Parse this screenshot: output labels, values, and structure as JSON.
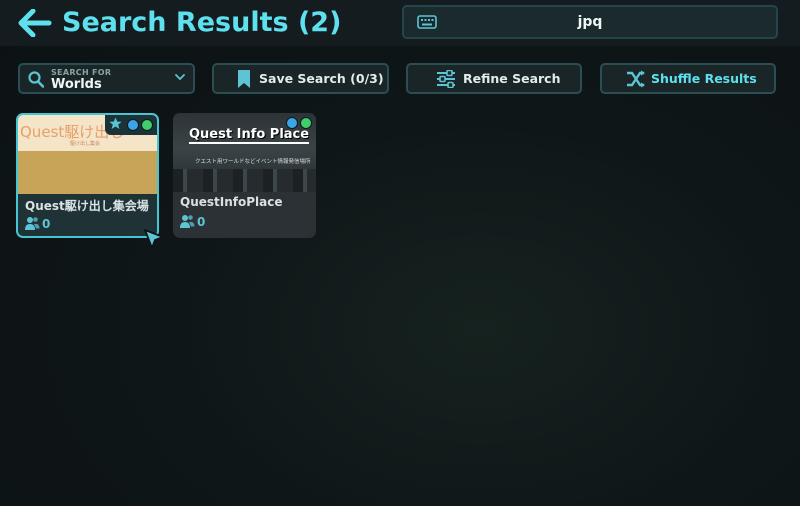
{
  "header": {
    "title": "Search Results (2)",
    "back_icon": "arrow-left-icon"
  },
  "search": {
    "value": "jpq",
    "icon": "keyboard-icon"
  },
  "toolbar": {
    "filter": {
      "caption": "SEARCH FOR",
      "value": "Worlds",
      "icon": "search-icon"
    },
    "save_label": "Save Search (0/3)",
    "refine_label": "Refine Search",
    "shuffle_label": "Shuffle Results"
  },
  "results": [
    {
      "name": "Quest駆け出し集会場",
      "players": "0",
      "thumb_title": "Quest駆け出し",
      "thumb_subtitle": "駆け出し集会",
      "favorite": true
    },
    {
      "name": "QuestInfoPlace",
      "players": "0",
      "thumb_title": "Quest Info Place",
      "thumb_subtitle": "クエスト用ワールドなどイベント情報発信場所"
    }
  ],
  "colors": {
    "accent": "#5ee0ee",
    "panel": "#1a2528",
    "border": "#2a4e53",
    "selected_border": "#46c6d4"
  }
}
